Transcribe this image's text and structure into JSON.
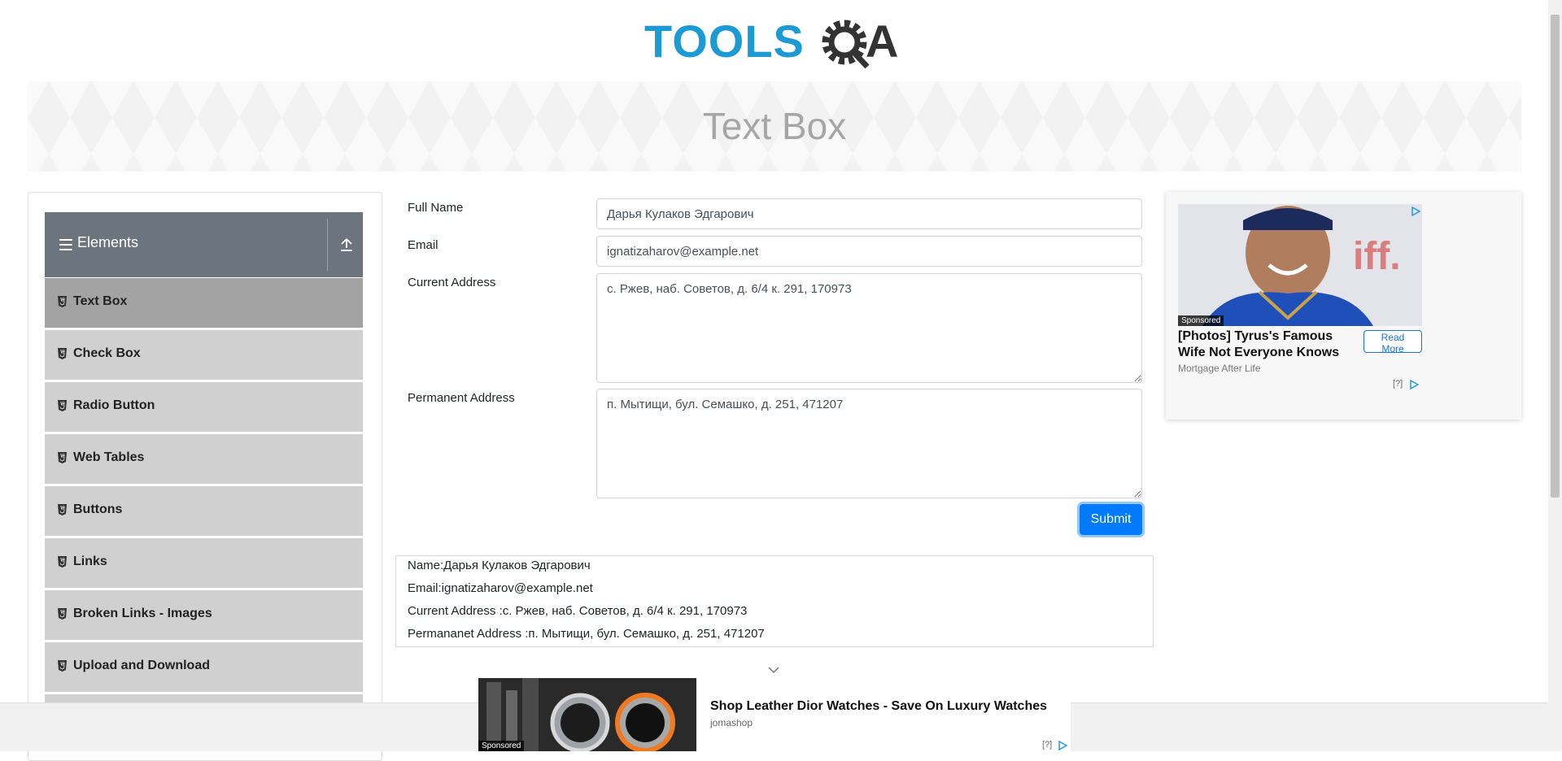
{
  "header": {
    "logo": {
      "text_tools": "TOOLS",
      "text_a": "A",
      "color_blue": "#1b9ad6",
      "color_dark": "#333333"
    },
    "page_title": "Text Box"
  },
  "sidebar": {
    "group_title": "Elements",
    "group_icon": "hamburger-icon",
    "collapse_icon": "upload-arrow-icon",
    "items": [
      {
        "label": "Text Box",
        "active": true
      },
      {
        "label": "Check Box",
        "active": false
      },
      {
        "label": "Radio Button",
        "active": false
      },
      {
        "label": "Web Tables",
        "active": false
      },
      {
        "label": "Buttons",
        "active": false
      },
      {
        "label": "Links",
        "active": false
      },
      {
        "label": "Broken Links - Images",
        "active": false
      },
      {
        "label": "Upload and Download",
        "active": false
      }
    ]
  },
  "form": {
    "full_name_label": "Full Name",
    "full_name_value": "Дарья Кулаков Эдгарович",
    "email_label": "Email",
    "email_value": "ignatizaharov@example.net",
    "current_address_label": "Current Address",
    "current_address_value": "с. Ржев, наб. Советов, д. 6/4 к. 291, 170973",
    "permanent_address_label": "Permanent Address",
    "permanent_address_value": "п. Мытищи, бул. Семашко, д. 251, 471207",
    "submit_label": "Submit"
  },
  "output": {
    "name": "Name:Дарья Кулаков Эдгарович",
    "email": "Email:ignatizaharov@example.net",
    "current_address": "Current Address :с. Ржев, наб. Советов, д. 6/4 к. 291, 170973",
    "permanent_address": "Permananet Address :п. Мытищи, бул. Семашко, д. 251, 471207"
  },
  "ad_right": {
    "sponsored": "Sponsored",
    "headline": "[Photos] Tyrus's Famous Wife Not Everyone Knows",
    "source": "Mortgage After Life",
    "cta": "Read More",
    "info": "[?]"
  },
  "ad_bottom": {
    "sponsored": "Sponsored",
    "headline": "Shop Leather Dior Watches - Save On Luxury Watches",
    "brand": "jomashop",
    "info": "[?]"
  },
  "colors": {
    "accent": "#007bff",
    "sidebar_header": "#6c757d",
    "menu_item": "#d0d0d0",
    "menu_active": "#a3a3a3"
  }
}
